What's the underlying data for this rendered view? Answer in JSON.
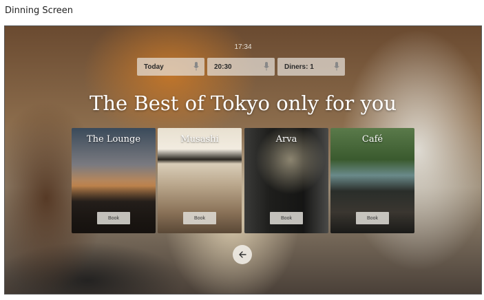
{
  "page": {
    "title": "Dinning Screen"
  },
  "screen": {
    "time": "17:34",
    "filters": [
      {
        "label": "Today",
        "icon": "microphone-icon"
      },
      {
        "label": "20:30",
        "icon": "microphone-icon"
      },
      {
        "label": "Diners: 1",
        "icon": "microphone-icon"
      }
    ],
    "headline": "The Best of Tokyo only for you",
    "restaurants": [
      {
        "name": "The Lounge",
        "book_label": "Book"
      },
      {
        "name": "Musashi",
        "book_label": "Book"
      },
      {
        "name": "Arva",
        "book_label": "Book"
      },
      {
        "name": "Café",
        "book_label": "Book"
      }
    ],
    "back_icon": "arrow-left-icon"
  }
}
